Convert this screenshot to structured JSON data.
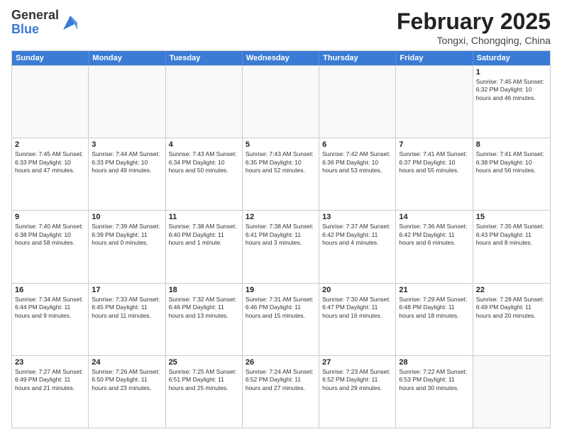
{
  "header": {
    "logo_general": "General",
    "logo_blue": "Blue",
    "month_title": "February 2025",
    "location": "Tongxi, Chongqing, China"
  },
  "days_of_week": [
    "Sunday",
    "Monday",
    "Tuesday",
    "Wednesday",
    "Thursday",
    "Friday",
    "Saturday"
  ],
  "weeks": [
    [
      {
        "day": "",
        "empty": true
      },
      {
        "day": "",
        "empty": true
      },
      {
        "day": "",
        "empty": true
      },
      {
        "day": "",
        "empty": true
      },
      {
        "day": "",
        "empty": true
      },
      {
        "day": "",
        "empty": true
      },
      {
        "day": "1",
        "text": "Sunrise: 7:45 AM\nSunset: 6:32 PM\nDaylight: 10 hours\nand 46 minutes."
      }
    ],
    [
      {
        "day": "2",
        "text": "Sunrise: 7:45 AM\nSunset: 6:33 PM\nDaylight: 10 hours\nand 47 minutes."
      },
      {
        "day": "3",
        "text": "Sunrise: 7:44 AM\nSunset: 6:33 PM\nDaylight: 10 hours\nand 49 minutes."
      },
      {
        "day": "4",
        "text": "Sunrise: 7:43 AM\nSunset: 6:34 PM\nDaylight: 10 hours\nand 50 minutes."
      },
      {
        "day": "5",
        "text": "Sunrise: 7:43 AM\nSunset: 6:35 PM\nDaylight: 10 hours\nand 52 minutes."
      },
      {
        "day": "6",
        "text": "Sunrise: 7:42 AM\nSunset: 6:36 PM\nDaylight: 10 hours\nand 53 minutes."
      },
      {
        "day": "7",
        "text": "Sunrise: 7:41 AM\nSunset: 6:37 PM\nDaylight: 10 hours\nand 55 minutes."
      },
      {
        "day": "8",
        "text": "Sunrise: 7:41 AM\nSunset: 6:38 PM\nDaylight: 10 hours\nand 56 minutes."
      }
    ],
    [
      {
        "day": "9",
        "text": "Sunrise: 7:40 AM\nSunset: 6:38 PM\nDaylight: 10 hours\nand 58 minutes."
      },
      {
        "day": "10",
        "text": "Sunrise: 7:39 AM\nSunset: 6:39 PM\nDaylight: 11 hours\nand 0 minutes."
      },
      {
        "day": "11",
        "text": "Sunrise: 7:38 AM\nSunset: 6:40 PM\nDaylight: 11 hours\nand 1 minute."
      },
      {
        "day": "12",
        "text": "Sunrise: 7:38 AM\nSunset: 6:41 PM\nDaylight: 11 hours\nand 3 minutes."
      },
      {
        "day": "13",
        "text": "Sunrise: 7:37 AM\nSunset: 6:42 PM\nDaylight: 11 hours\nand 4 minutes."
      },
      {
        "day": "14",
        "text": "Sunrise: 7:36 AM\nSunset: 6:42 PM\nDaylight: 11 hours\nand 6 minutes."
      },
      {
        "day": "15",
        "text": "Sunrise: 7:35 AM\nSunset: 6:43 PM\nDaylight: 11 hours\nand 8 minutes."
      }
    ],
    [
      {
        "day": "16",
        "text": "Sunrise: 7:34 AM\nSunset: 6:44 PM\nDaylight: 11 hours\nand 9 minutes."
      },
      {
        "day": "17",
        "text": "Sunrise: 7:33 AM\nSunset: 6:45 PM\nDaylight: 11 hours\nand 11 minutes."
      },
      {
        "day": "18",
        "text": "Sunrise: 7:32 AM\nSunset: 6:46 PM\nDaylight: 11 hours\nand 13 minutes."
      },
      {
        "day": "19",
        "text": "Sunrise: 7:31 AM\nSunset: 6:46 PM\nDaylight: 11 hours\nand 15 minutes."
      },
      {
        "day": "20",
        "text": "Sunrise: 7:30 AM\nSunset: 6:47 PM\nDaylight: 11 hours\nand 16 minutes."
      },
      {
        "day": "21",
        "text": "Sunrise: 7:29 AM\nSunset: 6:48 PM\nDaylight: 11 hours\nand 18 minutes."
      },
      {
        "day": "22",
        "text": "Sunrise: 7:28 AM\nSunset: 6:49 PM\nDaylight: 11 hours\nand 20 minutes."
      }
    ],
    [
      {
        "day": "23",
        "text": "Sunrise: 7:27 AM\nSunset: 6:49 PM\nDaylight: 11 hours\nand 21 minutes."
      },
      {
        "day": "24",
        "text": "Sunrise: 7:26 AM\nSunset: 6:50 PM\nDaylight: 11 hours\nand 23 minutes."
      },
      {
        "day": "25",
        "text": "Sunrise: 7:25 AM\nSunset: 6:51 PM\nDaylight: 11 hours\nand 25 minutes."
      },
      {
        "day": "26",
        "text": "Sunrise: 7:24 AM\nSunset: 6:52 PM\nDaylight: 11 hours\nand 27 minutes."
      },
      {
        "day": "27",
        "text": "Sunrise: 7:23 AM\nSunset: 6:52 PM\nDaylight: 11 hours\nand 29 minutes."
      },
      {
        "day": "28",
        "text": "Sunrise: 7:22 AM\nSunset: 6:53 PM\nDaylight: 11 hours\nand 30 minutes."
      },
      {
        "day": "",
        "empty": true
      }
    ]
  ]
}
